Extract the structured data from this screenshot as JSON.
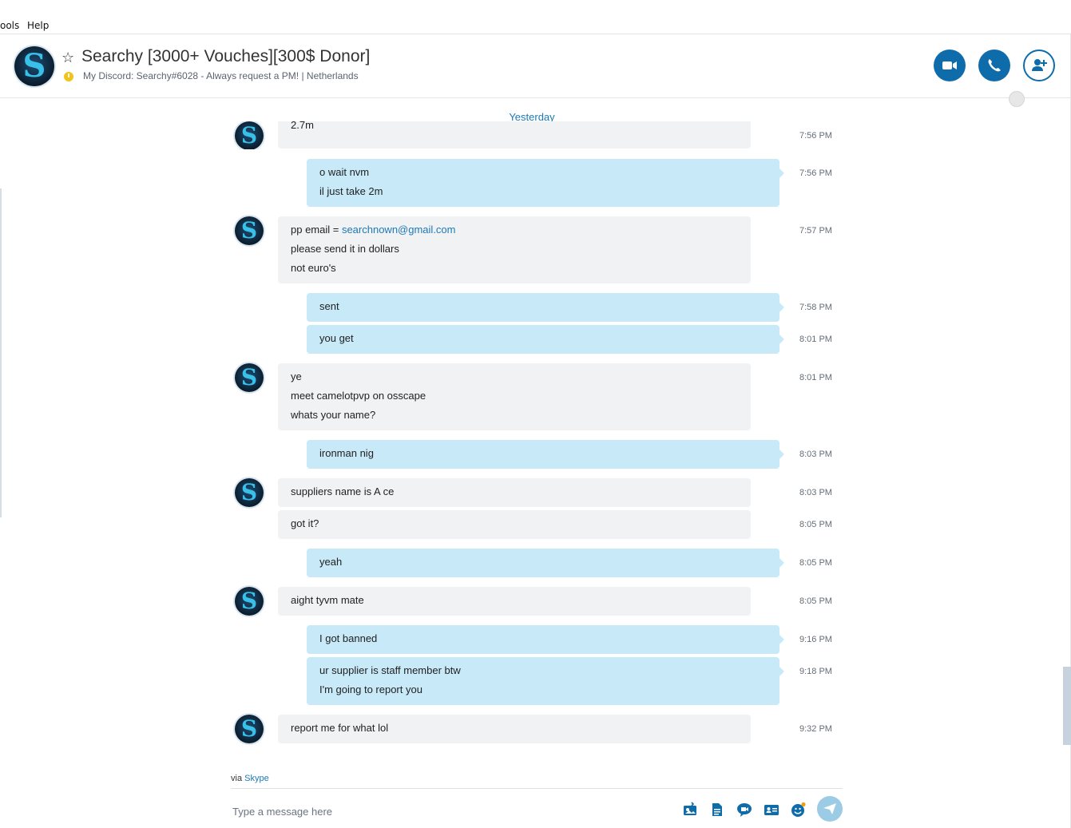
{
  "menu": {
    "tools": "ools",
    "help": "Help"
  },
  "header": {
    "title": "Searchy [3000+ Vouches][300$ Donor]",
    "mood": "My Discord: Searchy#6028 - Always request a PM!  |  Netherlands",
    "buttons": [
      "video-call",
      "audio-call",
      "add-people"
    ]
  },
  "day_divider": "Yesterday",
  "messages": [
    {
      "lines": [
        "2.7m"
      ],
      "time": "7:56 PM",
      "sender": "them"
    },
    {
      "lines": [
        "o wait nvm",
        "il just take 2m"
      ],
      "time": "7:56 PM",
      "sender": "me"
    },
    {
      "lines": [
        "pp email = ",
        "searchnown@gmail.com",
        "please send it in dollars",
        "not euro's"
      ],
      "time": "7:57 PM",
      "sender": "them"
    },
    {
      "lines": [
        "sent"
      ],
      "time": "7:58 PM",
      "sender": "me"
    },
    {
      "lines": [
        "you get"
      ],
      "time": "8:01 PM",
      "sender": "me"
    },
    {
      "lines": [
        "ye",
        "meet camelotpvp on osscape",
        "whats your name?"
      ],
      "time": "8:01 PM",
      "sender": "them"
    },
    {
      "lines": [
        "ironman nig"
      ],
      "time": "8:03 PM",
      "sender": "me"
    },
    {
      "lines": [
        "suppliers name is A ce"
      ],
      "time": "8:03 PM",
      "sender": "them"
    },
    {
      "lines": [
        "got it?"
      ],
      "time": "8:05 PM",
      "sender": "them"
    },
    {
      "lines": [
        "yeah"
      ],
      "time": "8:05 PM",
      "sender": "me"
    },
    {
      "lines": [
        "aight tyvm mate"
      ],
      "time": "8:05 PM",
      "sender": "them"
    },
    {
      "lines": [
        "I got banned"
      ],
      "time": "9:16 PM",
      "sender": "me"
    },
    {
      "lines": [
        "ur supplier is staff member btw",
        "I'm going to report you"
      ],
      "time": "9:18 PM",
      "sender": "me"
    },
    {
      "lines": [
        "report me for what lol"
      ],
      "time": "9:32 PM",
      "sender": "them"
    }
  ],
  "via": {
    "prefix": "via ",
    "app": "Skype"
  },
  "compose": {
    "placeholder": "Type a message here"
  },
  "toolbar_icons": [
    "send-media-icon",
    "send-file-icon",
    "video-message-icon",
    "contact-card-icon",
    "emoticon-icon",
    "send-icon"
  ],
  "colors": {
    "accent": "#0e6cab",
    "outgoing_bubble": "#c7e9f8",
    "incoming_bubble": "#f1f2f4",
    "status_away": "#f0c419"
  }
}
